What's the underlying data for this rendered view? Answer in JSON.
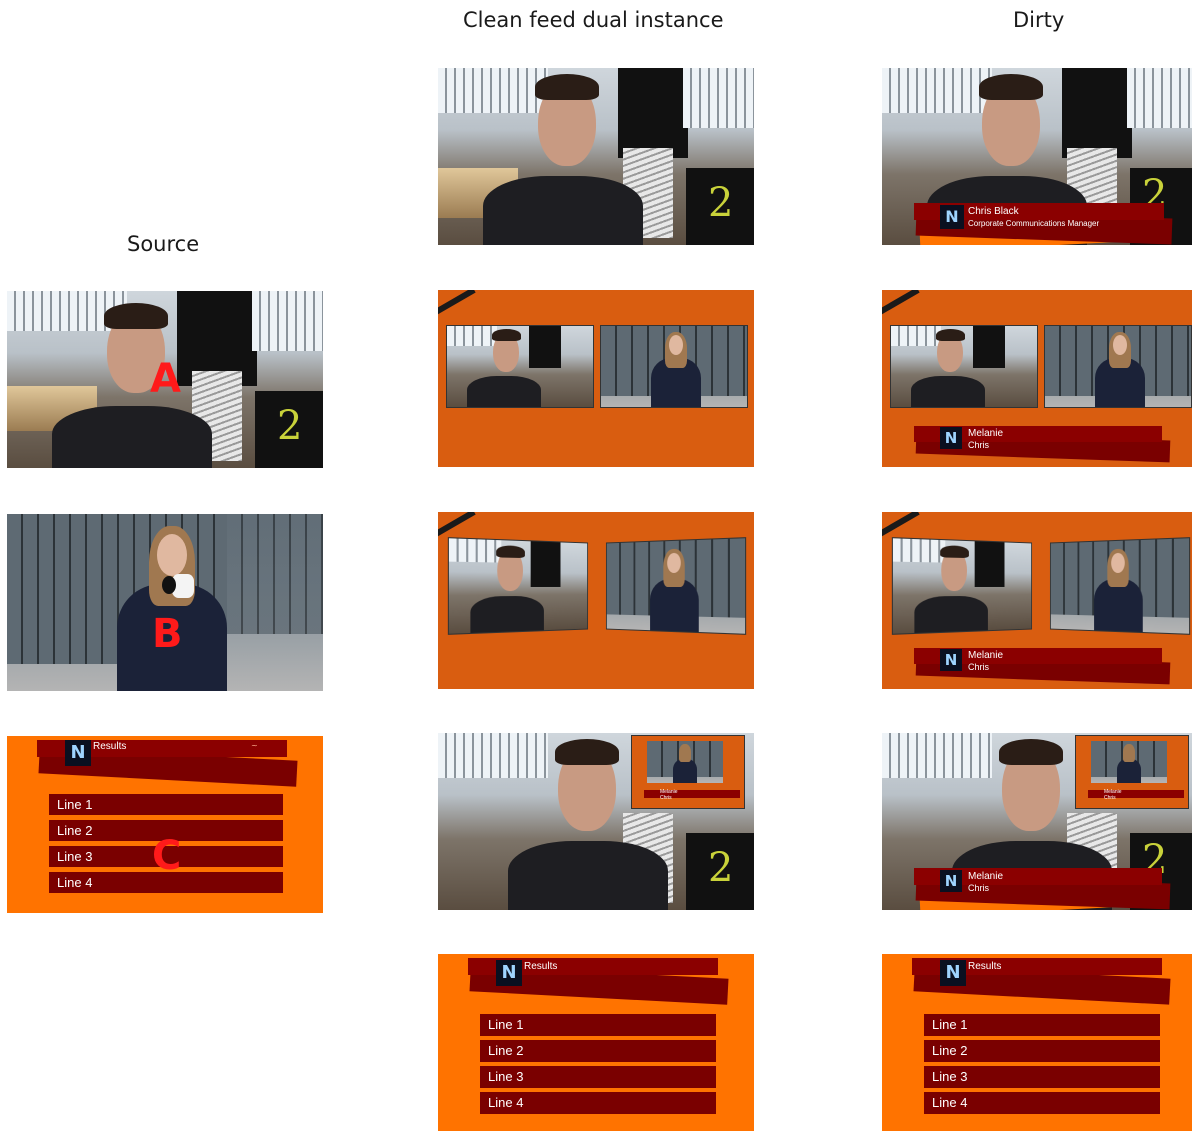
{
  "columns": {
    "source": "Source",
    "clean": "Clean feed dual instance",
    "dirty": "Dirty"
  },
  "source_letters": {
    "a": "A",
    "b": "B",
    "c": "C"
  },
  "lower_third": {
    "single_name": "Chris Black",
    "single_title": "Corporate Communications Manager",
    "dual_line1": "Melanie",
    "dual_line2": "Chris",
    "pip_line1": "Melanie",
    "pip_line2": "Chris"
  },
  "results": {
    "heading": "Results",
    "lines": [
      "Line 1",
      "Line 2",
      "Line 3",
      "Line 4"
    ]
  },
  "logo_glyph": "N",
  "colors": {
    "orange": "#ff7300",
    "dark_orange": "#d95d10",
    "maroon": "#7a0000",
    "letter_red": "#ff1a1a"
  }
}
